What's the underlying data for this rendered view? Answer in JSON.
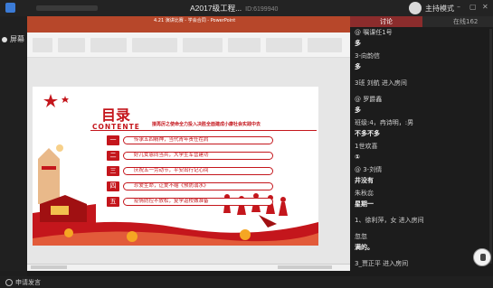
{
  "window": {
    "title": "A2017级工程...",
    "meeting_id": "ID:6199940",
    "host_label": "主持模式"
  },
  "left": {
    "share_label": "屏幕"
  },
  "ppt": {
    "title": "4.21 演讲比赛 - 学会合同 - PowerPoint",
    "slide": {
      "title": "目录",
      "subtitle_en": "CONTENTE",
      "headline": "接再厉之使命全力投入决胜全面建成小康社会实践中去",
      "items": [
        {
          "num": "一",
          "text": "传承五四精神，当代青年责任在肩"
        },
        {
          "num": "二",
          "text": "好儿女恩同当兵，大学生军营建功"
        },
        {
          "num": "三",
          "text": "庆祝五一劳动节，平安出行记心间"
        },
        {
          "num": "四",
          "text": "珍爱生命，让爱不缩《预防溺水》"
        },
        {
          "num": "五",
          "text": "疫情防控不放松，复学返校做准备"
        }
      ]
    }
  },
  "panel": {
    "tab_active": "讨论",
    "tab_inactive": "在线162"
  },
  "chat": [
    {
      "text": "@ 嘱课任1号",
      "bold": false
    },
    {
      "text": "多",
      "bold": true
    },
    {
      "text": "3-向韵信",
      "bold": false
    },
    {
      "text": "多",
      "bold": true
    },
    {
      "text": "3班 刘航 进入房间",
      "bold": false
    },
    {
      "text": "@ 罗爵鑫",
      "bold": false
    },
    {
      "text": "多",
      "bold": true
    },
    {
      "text": "班级:4，冉诗明，:男",
      "bold": false
    },
    {
      "text": "不多不多",
      "bold": true
    },
    {
      "text": "1世欢喜",
      "bold": false
    },
    {
      "text": "①",
      "bold": true
    },
    {
      "text": "@ 3-刘倩",
      "bold": false
    },
    {
      "text": "井没有",
      "bold": true
    },
    {
      "text": "朱秋惢",
      "bold": false
    },
    {
      "text": "星期一",
      "bold": true
    },
    {
      "text": "1、徐利萍，女 进入房间",
      "bold": false
    },
    {
      "text": "忽忽",
      "bold": false
    },
    {
      "text": "满的。",
      "bold": true
    },
    {
      "text": "3_贾正平 进入房间",
      "bold": false
    }
  ],
  "bottom": {
    "raise_hand_label": "申请发言"
  }
}
